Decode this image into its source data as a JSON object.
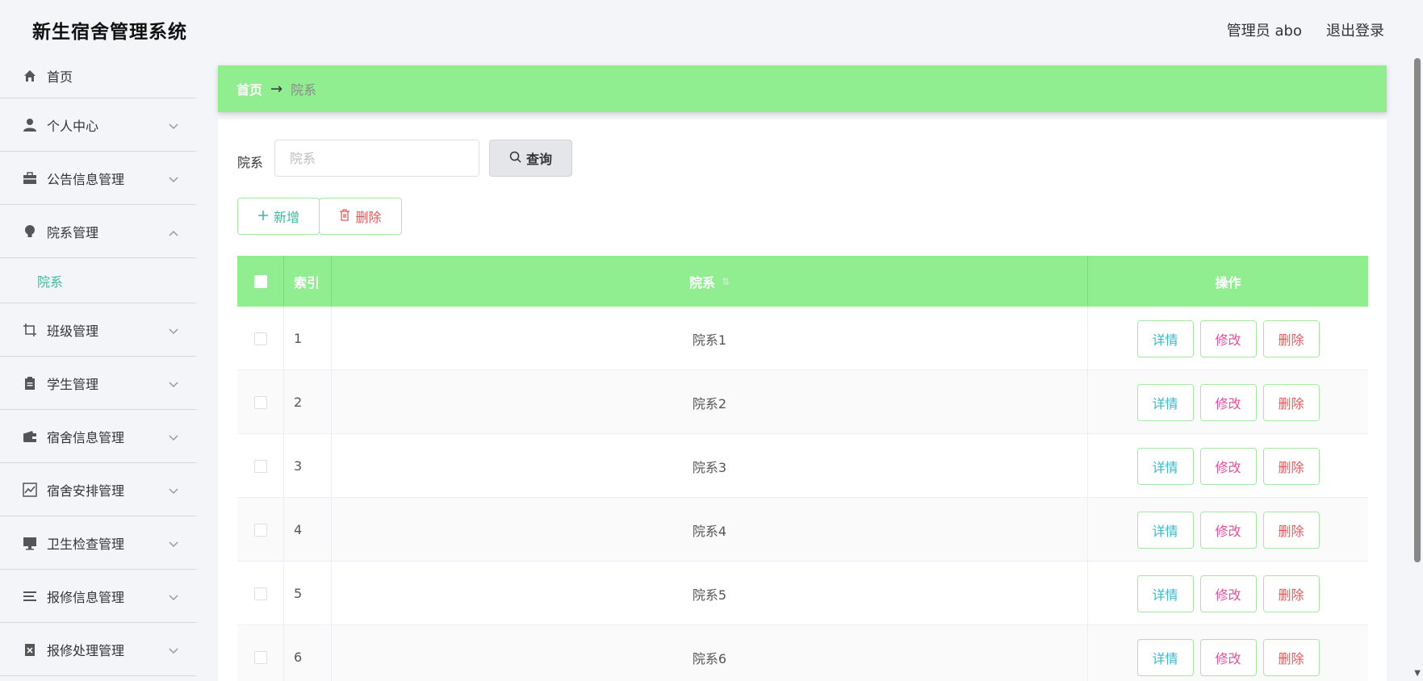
{
  "app": {
    "title": "新生宿舍管理系统"
  },
  "user": {
    "label": "管理员 abo",
    "logout": "退出登录"
  },
  "sidebar": {
    "items": [
      {
        "label": "首页",
        "icon": "home-icon"
      },
      {
        "label": "个人中心",
        "icon": "user-icon"
      },
      {
        "label": "公告信息管理",
        "icon": "briefcase-icon"
      },
      {
        "label": "院系管理",
        "icon": "bulb-icon",
        "expanded": true,
        "sub": "院系"
      },
      {
        "label": "班级管理",
        "icon": "crop-icon"
      },
      {
        "label": "学生管理",
        "icon": "clipboard-icon"
      },
      {
        "label": "宿舍信息管理",
        "icon": "wallet-icon"
      },
      {
        "label": "宿舍安排管理",
        "icon": "chart-icon"
      },
      {
        "label": "卫生检查管理",
        "icon": "monitor-icon"
      },
      {
        "label": "报修信息管理",
        "icon": "list-icon"
      },
      {
        "label": "报修处理管理",
        "icon": "doc-x-icon"
      }
    ]
  },
  "breadcrumb": {
    "home": "首页",
    "arrow": "→",
    "current": "院系"
  },
  "search": {
    "label": "院系",
    "placeholder": "院系",
    "value": "",
    "button": "查询"
  },
  "actions": {
    "add": "新增",
    "delete": "删除"
  },
  "table": {
    "headers": {
      "index": "索引",
      "name": "院系",
      "ops": "操作"
    },
    "rows": [
      {
        "index": "1",
        "name": "院系1"
      },
      {
        "index": "2",
        "name": "院系2"
      },
      {
        "index": "3",
        "name": "院系3"
      },
      {
        "index": "4",
        "name": "院系4"
      },
      {
        "index": "5",
        "name": "院系5"
      },
      {
        "index": "6",
        "name": "院系6"
      }
    ],
    "ops": {
      "detail": "详情",
      "edit": "修改",
      "delete": "删除"
    }
  },
  "colors": {
    "accent": "#90ee90",
    "active": "#3cb9a0",
    "danger": "#e05a5a",
    "edit": "#e4509a",
    "detail": "#3ab8c8"
  }
}
